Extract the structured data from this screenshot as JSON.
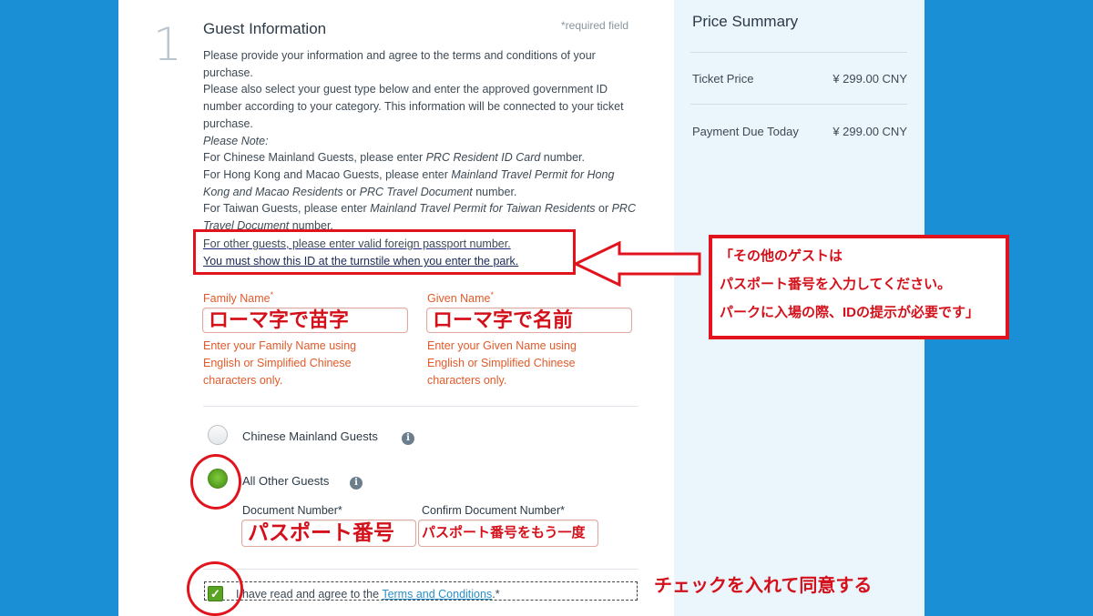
{
  "form": {
    "step_number": "1",
    "title": "Guest Information",
    "required_note": "*required field",
    "intro": {
      "line1": "Please provide your information and agree to the terms and conditions of your purchase.",
      "line2": "Please also select your guest type below and enter the approved government ID number according to your category. This information will be connected to your ticket purchase.",
      "note_label": "Please Note:",
      "mainland_prefix": "For Chinese Mainland Guests, please enter ",
      "mainland_doc": "PRC Resident ID Card",
      "mainland_suffix": " number.",
      "hkmacao_prefix": "For Hong Kong and Macao Guests, please enter ",
      "hkmacao_doc1": "Mainland Travel Permit for Hong Kong and Macao Residents",
      "hkmacao_mid": " or ",
      "hkmacao_doc2": "PRC Travel Document",
      "hkmacao_suffix": " number.",
      "taiwan_prefix": "For Taiwan Guests, please enter ",
      "taiwan_doc1": "Mainland Travel Permit for Taiwan Residents",
      "taiwan_mid": " or ",
      "taiwan_doc2": "PRC Travel Document",
      "taiwan_suffix": " number."
    },
    "other_guests_line": "For other guests, please enter valid foreign passport number.",
    "turnstile_line": "You must show this ID at the turnstile when you enter the park.",
    "family_name": {
      "label": "Family Name",
      "required_mark": "*",
      "value": "ローマ字で苗字",
      "hint": "Enter your Family Name using English or Simplified Chinese characters only."
    },
    "given_name": {
      "label": "Given Name",
      "required_mark": "*",
      "value": "ローマ字で名前",
      "hint": "Enter your Given Name using English or Simplified Chinese characters only."
    },
    "guest_types": [
      {
        "label": "Chinese Mainland Guests",
        "selected": false
      },
      {
        "label": "All Other Guests",
        "selected": true
      }
    ],
    "document_number": {
      "label": "Document Number*",
      "value": "パスポート番号"
    },
    "confirm_document_number": {
      "label": "Confirm Document Number*",
      "value": "パスポート番号をもう一度"
    },
    "terms": {
      "prefix": "I have read and agree to the ",
      "link": "Terms and Conditions",
      "suffix": ".*",
      "checked": true
    }
  },
  "annotations": {
    "box_line1": "「その他のゲストは",
    "box_line2": "パスポート番号を入力してください。",
    "box_line3": "パークに入場の際、IDの提示が必要です」",
    "check_note": "チェックを入れて同意する"
  },
  "summary": {
    "title": "Price Summary",
    "ticket_price_label": "Ticket Price",
    "ticket_price_value": "¥ 299.00 CNY",
    "due_today_label": "Payment Due Today",
    "due_today_value": "¥ 299.00 CNY"
  },
  "colors": {
    "background": "#1a8fd6",
    "accent_red": "#e1141e",
    "selected_green": "#5aa424",
    "error_orange": "#e15a2a"
  }
}
